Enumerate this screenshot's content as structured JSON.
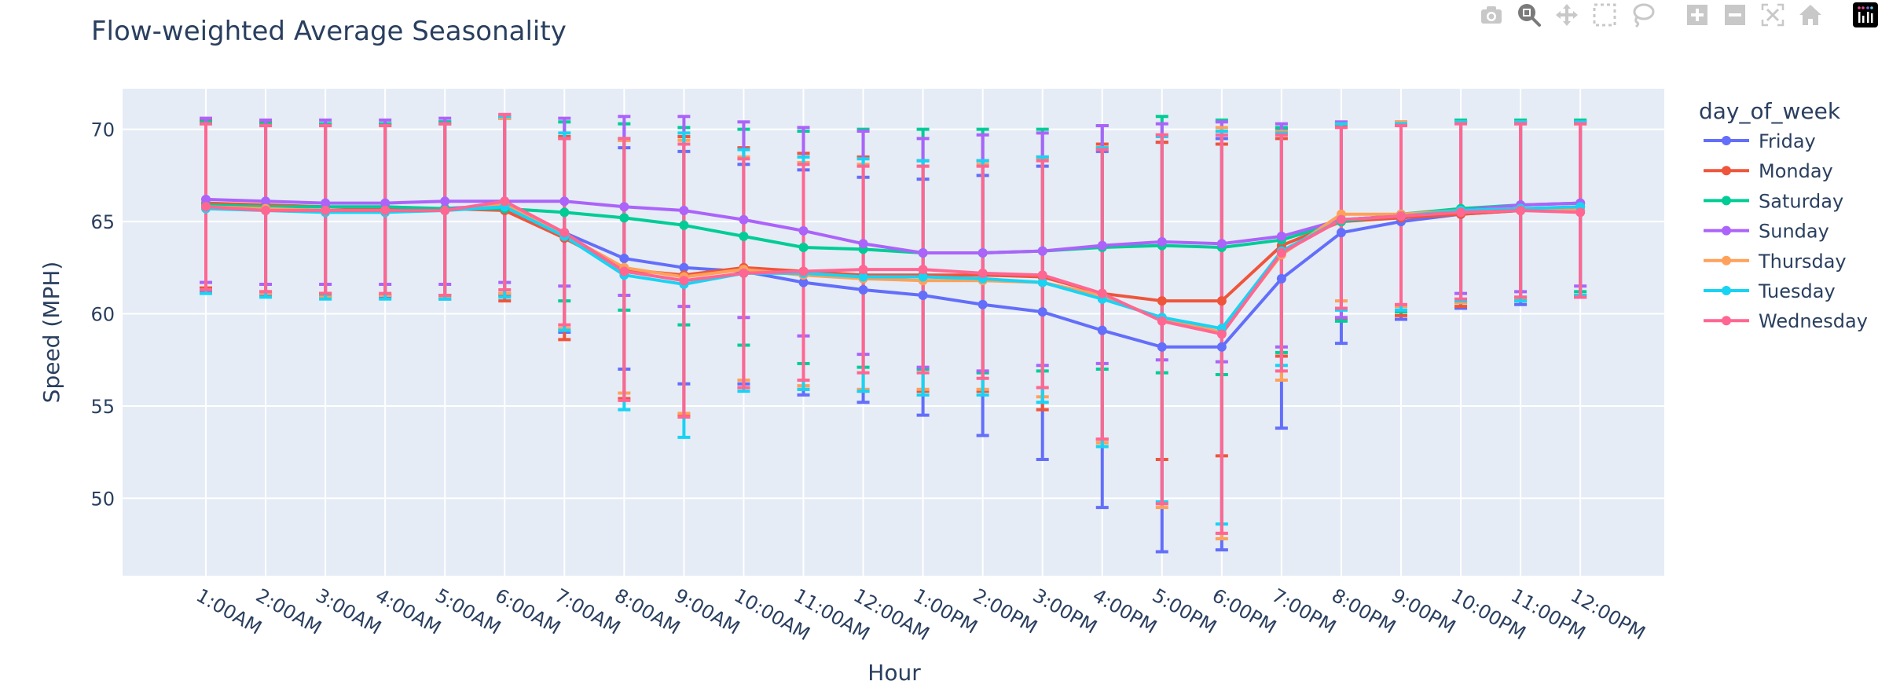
{
  "title": "Flow-weighted Average Seasonality",
  "modebar": {
    "buttons": [
      {
        "name": "download-plot-as-png",
        "icon": "camera-icon"
      },
      {
        "name": "zoom",
        "icon": "zoom-icon",
        "active": true
      },
      {
        "name": "pan",
        "icon": "pan-icon"
      },
      {
        "name": "box-select",
        "icon": "box-select-icon"
      },
      {
        "name": "lasso-select",
        "icon": "lasso-icon"
      },
      {
        "name": "zoom-in",
        "icon": "zoom-in-icon"
      },
      {
        "name": "zoom-out",
        "icon": "zoom-out-icon"
      },
      {
        "name": "autoscale",
        "icon": "autoscale-icon"
      },
      {
        "name": "reset-axes",
        "icon": "home-icon"
      },
      {
        "name": "plotly-logo",
        "icon": "plotly-logo-icon"
      }
    ]
  },
  "chart_data": {
    "type": "line",
    "title": "Flow-weighted Average Seasonality",
    "xlabel": "Hour",
    "ylabel": "Speed (MPH)",
    "ylim": [
      45.8,
      72.2
    ],
    "yticks": [
      50,
      55,
      60,
      65,
      70
    ],
    "grid": true,
    "legend_title": "day_of_week",
    "legend_position": "right",
    "error_bars": true,
    "x": [
      "1:00AM",
      "2:00AM",
      "3:00AM",
      "4:00AM",
      "5:00AM",
      "6:00AM",
      "7:00AM",
      "8:00AM",
      "9:00AM",
      "10:00AM",
      "11:00AM",
      "12:00AM",
      "1:00PM",
      "2:00PM",
      "3:00PM",
      "4:00PM",
      "5:00PM",
      "6:00PM",
      "7:00PM",
      "8:00PM",
      "9:00PM",
      "10:00PM",
      "11:00PM",
      "12:00PM"
    ],
    "series": [
      {
        "name": "Friday",
        "color": "#636efa",
        "values": [
          65.8,
          65.7,
          65.6,
          65.6,
          65.7,
          65.9,
          64.4,
          63.0,
          62.5,
          62.3,
          61.7,
          61.3,
          61.0,
          60.5,
          60.1,
          59.1,
          58.2,
          58.2,
          61.9,
          64.4,
          65.0,
          65.4,
          65.6,
          65.8
        ],
        "err_low": [
          61.2,
          61.0,
          60.9,
          60.9,
          60.8,
          61.0,
          59.0,
          57.0,
          56.2,
          56.2,
          55.6,
          55.2,
          54.5,
          53.4,
          52.1,
          49.5,
          47.1,
          47.2,
          53.8,
          58.4,
          59.7,
          60.3,
          60.5,
          60.9
        ],
        "err_high": [
          70.4,
          70.3,
          70.3,
          70.3,
          70.4,
          70.6,
          69.5,
          69.0,
          68.8,
          68.1,
          67.8,
          67.4,
          67.3,
          67.5,
          68.0,
          68.8,
          69.3,
          69.5,
          70.0,
          70.3,
          70.3,
          70.4,
          70.4,
          70.4
        ]
      },
      {
        "name": "Monday",
        "color": "#ef553b",
        "values": [
          66.0,
          65.9,
          65.8,
          65.7,
          65.7,
          65.6,
          64.1,
          62.4,
          62.1,
          62.5,
          62.3,
          62.1,
          62.1,
          62.1,
          62.0,
          61.1,
          60.7,
          60.7,
          63.7,
          65.0,
          65.2,
          65.4,
          65.6,
          65.6
        ],
        "err_low": [
          61.4,
          61.2,
          61.1,
          61.0,
          61.0,
          60.7,
          58.6,
          55.4,
          54.5,
          56.0,
          55.9,
          55.8,
          55.8,
          55.8,
          54.8,
          53.2,
          52.1,
          52.3,
          57.7,
          59.7,
          59.9,
          60.4,
          60.7,
          61.0
        ],
        "err_high": [
          70.5,
          70.4,
          70.3,
          70.3,
          70.3,
          70.6,
          69.6,
          69.4,
          69.6,
          69.0,
          68.7,
          68.5,
          68.3,
          68.3,
          68.5,
          69.2,
          69.3,
          69.2,
          69.5,
          70.2,
          70.3,
          70.4,
          70.3,
          70.3
        ]
      },
      {
        "name": "Saturday",
        "color": "#00cc96",
        "values": [
          65.9,
          65.8,
          65.8,
          65.8,
          65.7,
          65.7,
          65.5,
          65.2,
          64.8,
          64.2,
          63.6,
          63.5,
          63.3,
          63.3,
          63.4,
          63.6,
          63.7,
          63.6,
          64.0,
          65.0,
          65.4,
          65.7,
          65.9,
          66.0
        ],
        "err_low": [
          61.3,
          61.1,
          61.0,
          61.0,
          61.0,
          61.1,
          60.7,
          60.2,
          59.4,
          58.3,
          57.3,
          57.1,
          57.0,
          56.8,
          56.9,
          57.0,
          56.8,
          56.7,
          57.9,
          59.6,
          60.1,
          60.6,
          60.9,
          61.2
        ],
        "err_high": [
          70.4,
          70.3,
          70.3,
          70.3,
          70.4,
          70.7,
          70.4,
          70.3,
          70.1,
          70.0,
          69.9,
          70.0,
          70.0,
          70.0,
          70.0,
          70.2,
          70.7,
          70.5,
          70.1,
          70.3,
          70.3,
          70.5,
          70.5,
          70.5
        ]
      },
      {
        "name": "Sunday",
        "color": "#ab63fa",
        "values": [
          66.2,
          66.1,
          66.0,
          66.0,
          66.1,
          66.1,
          66.1,
          65.8,
          65.6,
          65.1,
          64.5,
          63.8,
          63.3,
          63.3,
          63.4,
          63.7,
          63.9,
          63.8,
          64.2,
          65.1,
          65.3,
          65.6,
          65.9,
          66.0
        ],
        "err_low": [
          61.7,
          61.6,
          61.6,
          61.6,
          61.6,
          61.7,
          61.5,
          61.0,
          60.4,
          59.8,
          58.8,
          57.8,
          57.1,
          56.9,
          57.2,
          57.3,
          57.5,
          57.4,
          58.2,
          59.8,
          60.2,
          61.1,
          61.2,
          61.5
        ],
        "err_high": [
          70.6,
          70.5,
          70.5,
          70.5,
          70.6,
          70.8,
          70.6,
          70.7,
          70.7,
          70.4,
          70.1,
          69.9,
          69.5,
          69.7,
          69.8,
          70.2,
          70.3,
          70.4,
          70.3,
          70.4,
          70.4,
          70.4,
          70.4,
          70.4
        ]
      },
      {
        "name": "Thursday",
        "color": "#ffa15a",
        "values": [
          65.8,
          65.7,
          65.6,
          65.6,
          65.6,
          65.9,
          64.3,
          62.5,
          62.0,
          62.4,
          62.1,
          61.9,
          61.8,
          61.8,
          61.7,
          61.0,
          59.7,
          59.0,
          63.2,
          65.4,
          65.4,
          65.6,
          65.7,
          65.6
        ],
        "err_low": [
          61.3,
          61.1,
          60.9,
          61.0,
          60.9,
          61.1,
          59.2,
          55.7,
          54.6,
          56.4,
          56.1,
          55.9,
          55.9,
          55.9,
          55.5,
          53.0,
          49.5,
          47.8,
          56.4,
          60.7,
          60.4,
          60.6,
          60.8,
          61.0
        ],
        "err_high": [
          70.3,
          70.2,
          70.2,
          70.2,
          70.3,
          70.6,
          69.5,
          69.4,
          69.4,
          68.5,
          68.2,
          68.1,
          68.0,
          68.1,
          68.4,
          69.0,
          69.7,
          70.1,
          69.9,
          70.3,
          70.4,
          70.4,
          70.4,
          70.3
        ]
      },
      {
        "name": "Tuesday",
        "color": "#19d3f3",
        "values": [
          65.7,
          65.6,
          65.5,
          65.5,
          65.6,
          65.8,
          64.2,
          62.1,
          61.6,
          62.2,
          62.2,
          62.0,
          62.0,
          61.9,
          61.7,
          60.8,
          59.8,
          59.2,
          63.4,
          65.1,
          65.3,
          65.6,
          65.7,
          65.8
        ],
        "err_low": [
          61.1,
          60.9,
          60.8,
          60.8,
          60.8,
          60.9,
          59.1,
          54.8,
          53.3,
          55.8,
          55.9,
          55.8,
          55.6,
          55.6,
          55.2,
          52.8,
          49.8,
          48.6,
          57.2,
          60.2,
          60.2,
          60.7,
          60.7,
          61.0
        ],
        "err_high": [
          70.3,
          70.2,
          70.2,
          70.2,
          70.3,
          70.7,
          69.8,
          69.5,
          69.8,
          68.9,
          68.5,
          68.4,
          68.3,
          68.3,
          68.5,
          69.0,
          69.6,
          69.9,
          69.8,
          70.3,
          70.3,
          70.4,
          70.4,
          70.4
        ]
      },
      {
        "name": "Wednesday",
        "color": "#ff6692",
        "values": [
          65.8,
          65.6,
          65.6,
          65.6,
          65.6,
          66.1,
          64.4,
          62.3,
          61.8,
          62.2,
          62.3,
          62.4,
          62.4,
          62.2,
          62.1,
          61.1,
          59.6,
          58.9,
          63.3,
          65.1,
          65.3,
          65.5,
          65.6,
          65.5
        ],
        "err_low": [
          61.3,
          61.2,
          61.1,
          61.1,
          61.0,
          61.3,
          59.4,
          55.3,
          54.4,
          56.0,
          56.4,
          56.8,
          56.8,
          56.5,
          56.0,
          53.2,
          49.7,
          48.1,
          56.9,
          60.3,
          60.5,
          60.8,
          60.9,
          60.9
        ],
        "err_high": [
          70.3,
          70.2,
          70.2,
          70.2,
          70.3,
          70.8,
          69.5,
          69.5,
          69.2,
          68.4,
          68.1,
          68.0,
          68.0,
          68.0,
          68.3,
          68.9,
          69.7,
          69.7,
          69.7,
          70.1,
          70.2,
          70.3,
          70.3,
          70.3
        ]
      }
    ]
  }
}
